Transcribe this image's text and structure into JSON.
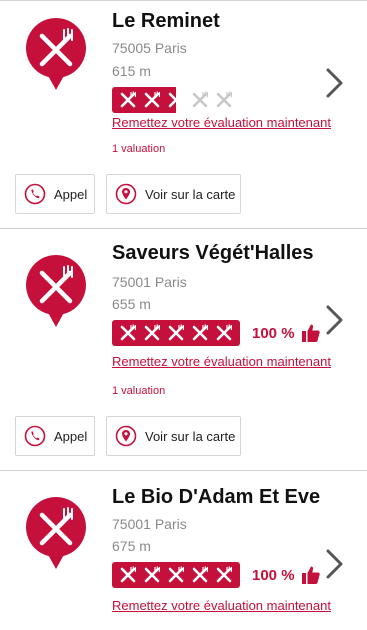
{
  "colors": {
    "accent": "#c5103c",
    "muted": "#8a8a8a",
    "empty_rating": "#c8c8c8"
  },
  "icons": {
    "logo": "restaurant-cutlery-pin-icon",
    "rating_unit": "cutlery-icon",
    "chevron": "chevron-right-icon",
    "call": "phone-icon",
    "map": "map-pin-icon",
    "thumb": "thumbs-up-icon"
  },
  "restaurants": [
    {
      "name": "Le Reminet",
      "address": "75005 Paris",
      "distance": "615 m",
      "rating": {
        "max": 5,
        "value": 2.5,
        "percent": ""
      },
      "evaluate_link": "Remettez votre évaluation maintenant",
      "ratings_count": "1 valuation",
      "actions": {
        "call": "Appel",
        "map": "Voir sur la carte"
      }
    },
    {
      "name": "Saveurs Végét'Halles",
      "address": "75001 Paris",
      "distance": "655 m",
      "rating": {
        "max": 5,
        "value": 5,
        "percent": "100 %"
      },
      "evaluate_link": "Remettez votre évaluation maintenant",
      "ratings_count": "1 valuation",
      "actions": {
        "call": "Appel",
        "map": "Voir sur la carte"
      }
    },
    {
      "name": "Le Bio D'Adam Et Eve",
      "address": "75001 Paris",
      "distance": "675 m",
      "rating": {
        "max": 5,
        "value": 5,
        "percent": "100 %"
      },
      "evaluate_link": "Remettez votre évaluation maintenant"
    }
  ]
}
